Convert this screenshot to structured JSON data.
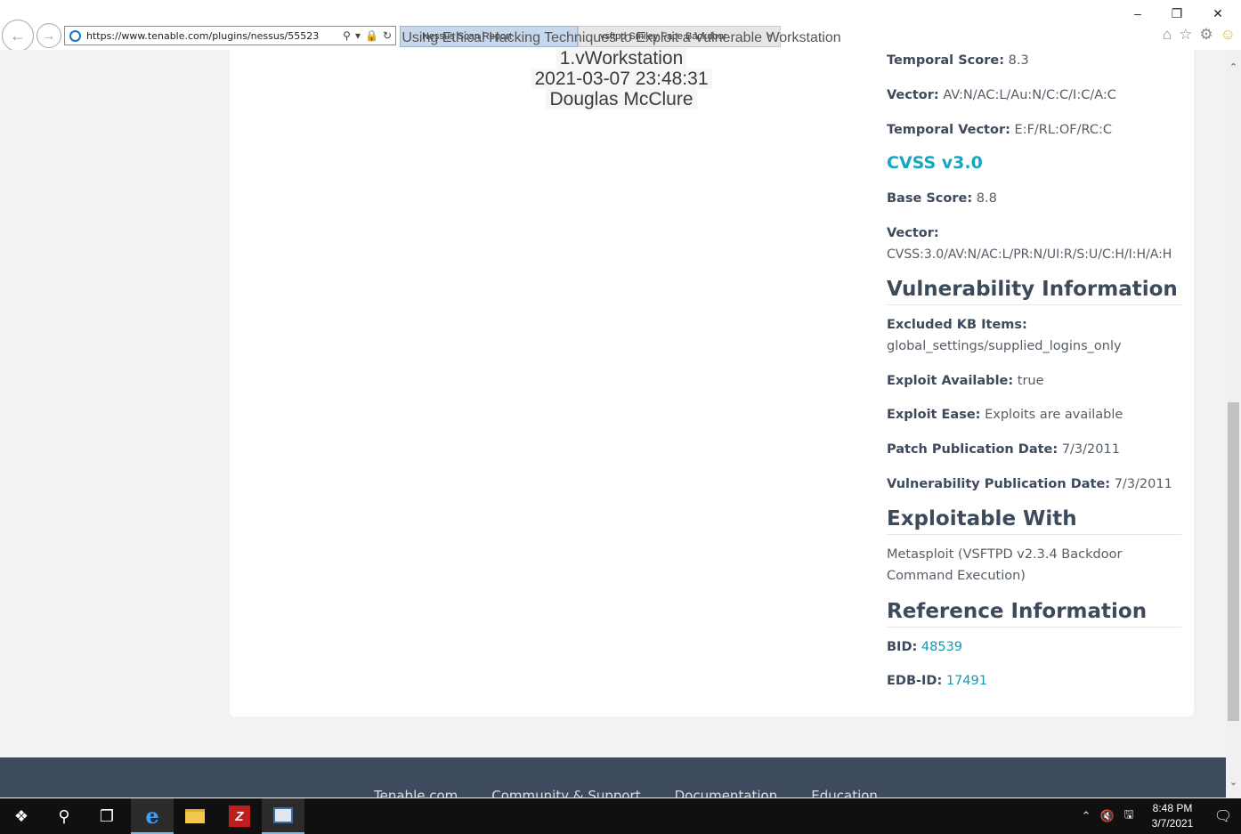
{
  "browser": {
    "url": "https://www.tenable.com/plugins/nessus/55523",
    "tabs": [
      {
        "label": "Nessus Scan Report"
      },
      {
        "label": "vsftpd Smiley Face Backdoor"
      }
    ],
    "window_controls": {
      "minimize": "–",
      "restore": "❐",
      "close": "✕"
    }
  },
  "watermark": {
    "title": "Using Ethical Hacking Techniques to Exploit a Vulnerable Workstation",
    "line1": "1.vWorkstation",
    "line2": "2021-03-07 23:48:31",
    "line3": "Douglas McClure"
  },
  "details": {
    "temporal_score_label": "Temporal Score:",
    "temporal_score_value": "8.3",
    "vector_label": "Vector:",
    "vector_value": "AV:N/AC:L/Au:N/C:C/I:C/A:C",
    "temporal_vector_label": "Temporal Vector:",
    "temporal_vector_value": "E:F/RL:OF/RC:C",
    "cvss3_heading": "CVSS v3.0",
    "base_score_label": "Base Score:",
    "base_score_value": "8.8",
    "vector3_label": "Vector:",
    "vector3_value": "CVSS:3.0/AV:N/AC:L/PR:N/UI:R/S:U/C:H/I:H/A:H",
    "vuln_info_heading": "Vulnerability Information",
    "excluded_kb_label": "Excluded KB Items:",
    "excluded_kb_value": "global_settings/supplied_logins_only",
    "exploit_available_label": "Exploit Available:",
    "exploit_available_value": "true",
    "exploit_ease_label": "Exploit Ease:",
    "exploit_ease_value": "Exploits are available",
    "patch_pub_label": "Patch Publication Date:",
    "patch_pub_value": "7/3/2011",
    "vuln_pub_label": "Vulnerability Publication Date:",
    "vuln_pub_value": "7/3/2011",
    "exploitable_heading": "Exploitable With",
    "exploitable_value": "Metasploit (VSFTPD v2.3.4 Backdoor Command Execution)",
    "reference_heading": "Reference Information",
    "bid_label": "BID:",
    "bid_value": "48539",
    "edb_label": "EDB-ID:",
    "edb_value": "17491"
  },
  "footer": {
    "links": [
      "Tenable.com",
      "Community & Support",
      "Documentation",
      "Education"
    ]
  },
  "taskbar": {
    "time": "8:48 PM",
    "date": "3/7/2021"
  }
}
